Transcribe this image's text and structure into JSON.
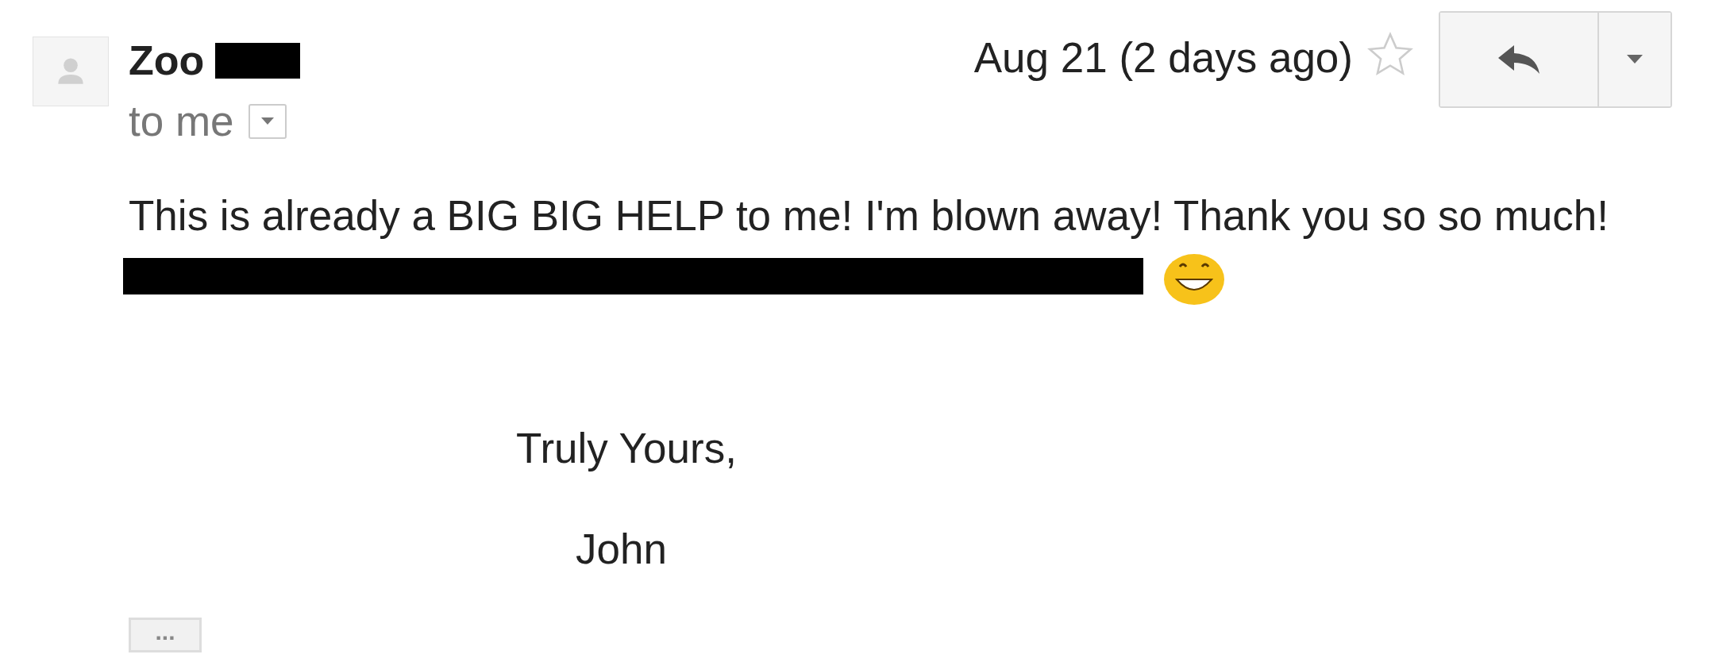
{
  "message": {
    "sender": "Zoo",
    "recipient": "to me",
    "date": "Aug 21 (2 days ago)",
    "starred": false,
    "body": "This is already a BIG BIG HELP to me! I'm blown away! Thank you so so much!",
    "closing": "Truly Yours,",
    "signature": "John",
    "trimmed_content": "..."
  }
}
